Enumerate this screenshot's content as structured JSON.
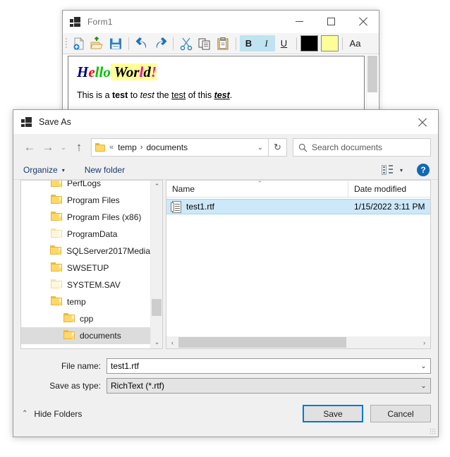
{
  "form1": {
    "title": "Form1",
    "app_icon": "form-icon",
    "caption": {
      "minimize": "—",
      "maximize": "□",
      "close": "✕"
    },
    "toolbar": {
      "buttons": [
        {
          "name": "new-document-button",
          "icon": "new-document-icon"
        },
        {
          "name": "open-folder-button",
          "icon": "open-folder-icon"
        },
        {
          "name": "save-button",
          "icon": "floppy-save-icon"
        },
        {
          "name": "undo-button",
          "icon": "undo-arrow-icon"
        },
        {
          "name": "redo-button",
          "icon": "redo-arrow-icon"
        },
        {
          "name": "cut-button",
          "icon": "scissors-icon"
        },
        {
          "name": "copy-button",
          "icon": "copy-icon"
        },
        {
          "name": "paste-button",
          "icon": "clipboard-paste-icon"
        }
      ],
      "bold_label": "B",
      "italic_label": "I",
      "underline_label": "U",
      "font_label": "Aa",
      "fore_color": "#000000",
      "back_color": "#FFFF99"
    },
    "document": {
      "heading_runs": [
        {
          "text": "H",
          "color": "#000080",
          "highlight": ""
        },
        {
          "text": "e",
          "color": "#FF0000",
          "highlight": ""
        },
        {
          "text": "ll",
          "color": "#00C000",
          "highlight": ""
        },
        {
          "text": "o",
          "color": "#00C000",
          "highlight": ""
        },
        {
          "text": " ",
          "color": "#000000",
          "highlight": "#FFFF99"
        },
        {
          "text": "Wor",
          "color": "#000000",
          "highlight": "#FFFF99"
        },
        {
          "text": "l",
          "color": "#FF00AA",
          "highlight": "#FFFF99"
        },
        {
          "text": "d",
          "color": "#000000",
          "highlight": "#FFFF99"
        },
        {
          "text": "!",
          "color": "#FF00AA",
          "highlight": "#FFFF99"
        }
      ],
      "body_runs": [
        {
          "text": "This is a ",
          "style": "normal"
        },
        {
          "text": "test",
          "style": "bold"
        },
        {
          "text": " to ",
          "style": "normal"
        },
        {
          "text": "test",
          "style": "italic"
        },
        {
          "text": " the ",
          "style": "normal"
        },
        {
          "text": "test",
          "style": "underline"
        },
        {
          "text": " of this ",
          "style": "normal"
        },
        {
          "text": "test",
          "style": "bold-italic-underline"
        },
        {
          "text": ".",
          "style": "normal"
        }
      ]
    }
  },
  "dialog": {
    "title": "Save As",
    "close_label": "✕",
    "nav": {
      "back": "←",
      "forward": "→",
      "recent_caret": "⌄",
      "up": "↑",
      "address_crumbs": [
        "«",
        "temp",
        "documents"
      ],
      "address_caret": "⌄",
      "refresh": "↻",
      "search_placeholder": "Search documents",
      "search_icon": "search-icon"
    },
    "commandbar": {
      "organize_label": "Organize",
      "organize_caret": "▾",
      "new_folder_label": "New folder",
      "viewmode_icon": "view-mode-icon",
      "viewmode_caret": "▾",
      "help_label": "?"
    },
    "tree": {
      "items": [
        {
          "label": "PerfLogs",
          "indent": 0,
          "faded": false,
          "selected": false
        },
        {
          "label": "Program Files",
          "indent": 0,
          "faded": false,
          "selected": false
        },
        {
          "label": "Program Files (x86)",
          "indent": 0,
          "faded": false,
          "selected": false
        },
        {
          "label": "ProgramData",
          "indent": 0,
          "faded": true,
          "selected": false
        },
        {
          "label": "SQLServer2017Media",
          "indent": 0,
          "faded": false,
          "selected": false
        },
        {
          "label": "SWSETUP",
          "indent": 0,
          "faded": false,
          "selected": false
        },
        {
          "label": "SYSTEM.SAV",
          "indent": 0,
          "faded": true,
          "selected": false
        },
        {
          "label": "temp",
          "indent": 0,
          "faded": false,
          "selected": false
        },
        {
          "label": "cpp",
          "indent": 1,
          "faded": false,
          "selected": false
        },
        {
          "label": "documents",
          "indent": 1,
          "faded": false,
          "selected": true
        }
      ],
      "scroll_up": "⌃",
      "scroll_down": "⌄"
    },
    "files": {
      "columns": [
        "Name",
        "Date modified"
      ],
      "sort_indicator": "⌃",
      "rows": [
        {
          "name": "test1.rtf",
          "date_modified": "1/15/2022 3:11 PM",
          "icon": "rtf-file-icon",
          "selected": true
        }
      ],
      "hscroll_left": "‹",
      "hscroll_right": "›"
    },
    "fields": {
      "file_name_label": "File name:",
      "file_name_value": "test1.rtf",
      "file_name_caret": "⌄",
      "save_as_type_label": "Save as type:",
      "save_as_type_value": "RichText (*.rtf)",
      "save_as_type_caret": "⌄"
    },
    "footer": {
      "hide_folders_caret": "⌃",
      "hide_folders_label": "Hide Folders",
      "save_label": "Save",
      "cancel_label": "Cancel"
    }
  }
}
